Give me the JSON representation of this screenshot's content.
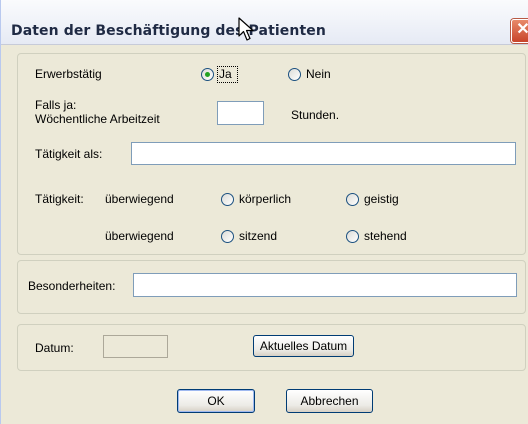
{
  "dialog": {
    "title": "Daten der Beschäftigung des Patienten",
    "close_glyph": "✕"
  },
  "employment": {
    "label": "Erwerbstätig",
    "options": [
      {
        "label": "Ja",
        "selected": true
      },
      {
        "label": "Nein",
        "selected": false
      }
    ],
    "hours_label_line1": "Falls ja:",
    "hours_label_line2": "Wöchentliche Arbeitzeit",
    "hours_value": "",
    "hours_unit": "Stunden.",
    "activity_label": "Tätigkeit als:",
    "activity_value": "",
    "type_label": "Tätigkeit:",
    "row1_label": "überwiegend",
    "row1_options": [
      {
        "label": "körperlich",
        "selected": false
      },
      {
        "label": "geistig",
        "selected": false
      }
    ],
    "row2_label": "überwiegend",
    "row2_options": [
      {
        "label": "sitzend",
        "selected": false
      },
      {
        "label": "stehend",
        "selected": false
      }
    ]
  },
  "special": {
    "label": "Besonderheiten:",
    "value": ""
  },
  "date": {
    "label": "Datum:",
    "value": "",
    "current_date_button": "Aktuelles Datum"
  },
  "buttons": {
    "ok": "OK",
    "cancel": "Abbrechen"
  },
  "icons": {
    "cursor": "mouse-pointer-icon",
    "close": "close-icon"
  }
}
